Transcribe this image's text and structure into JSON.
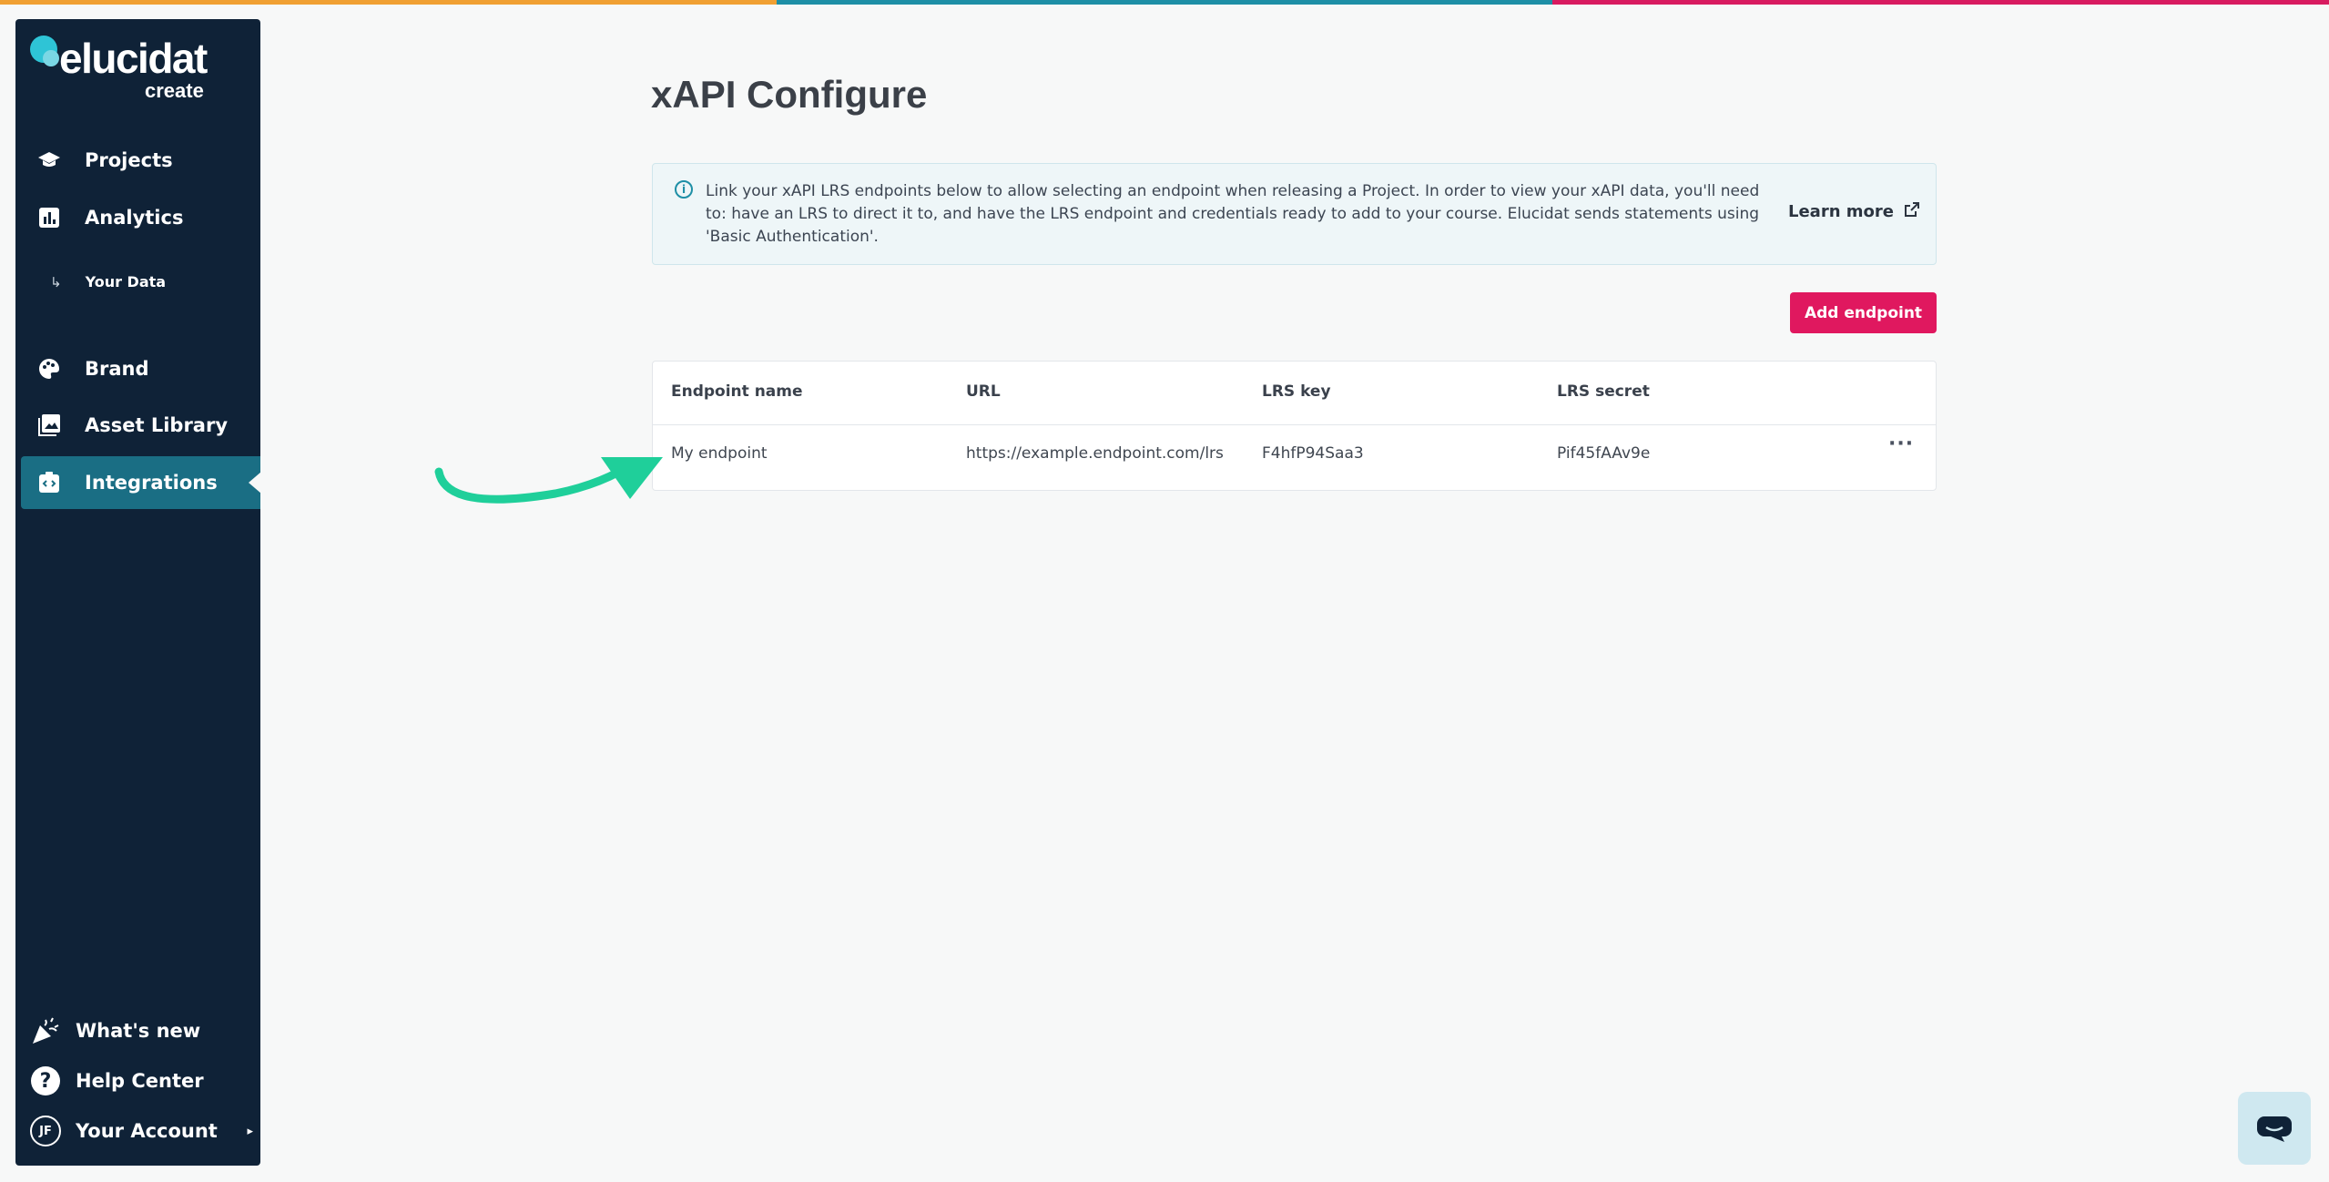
{
  "colors": {
    "stripe": [
      "#f0a033",
      "#1d8fa6",
      "#d81b60"
    ],
    "sidebar_bg": "#0f2237",
    "active_item_bg": "#1a6e84",
    "primary_button": "#e0185f",
    "annotation_arrow": "#1fcf9a"
  },
  "logo": {
    "word": "elucidat",
    "sub": "create"
  },
  "sidebar": {
    "items": [
      {
        "label": "Projects",
        "icon": "graduation-cap-icon"
      },
      {
        "label": "Analytics",
        "icon": "bar-chart-icon"
      },
      {
        "label": "Your Data",
        "icon": "sub-arrow-icon"
      },
      {
        "label": "Brand",
        "icon": "palette-icon"
      },
      {
        "label": "Asset Library",
        "icon": "image-library-icon"
      },
      {
        "label": "Integrations",
        "icon": "integrations-icon",
        "active": true
      }
    ],
    "bottom": {
      "whats_new": "What's new",
      "help_center": "Help Center",
      "account": "Your Account",
      "avatar_initials": "JF"
    }
  },
  "main": {
    "title": "xAPI Configure",
    "info_text": "Link your xAPI LRS endpoints below to allow selecting an endpoint when releasing a Project. In order to view your xAPI data, you'll need to: have an LRS to direct it to, and have the LRS endpoint and credentials ready to add to your course. Elucidat sends statements using 'Basic Authentication'.",
    "learn_more": "Learn more",
    "add_button": "Add endpoint",
    "table": {
      "headers": [
        "Endpoint name",
        "URL",
        "LRS key",
        "LRS secret"
      ],
      "rows": [
        [
          "My endpoint",
          "https://example.endpoint.com/lrs",
          "F4hfP94Saa3",
          "Pif45fAAv9e"
        ]
      ],
      "row_menu": "···"
    }
  }
}
